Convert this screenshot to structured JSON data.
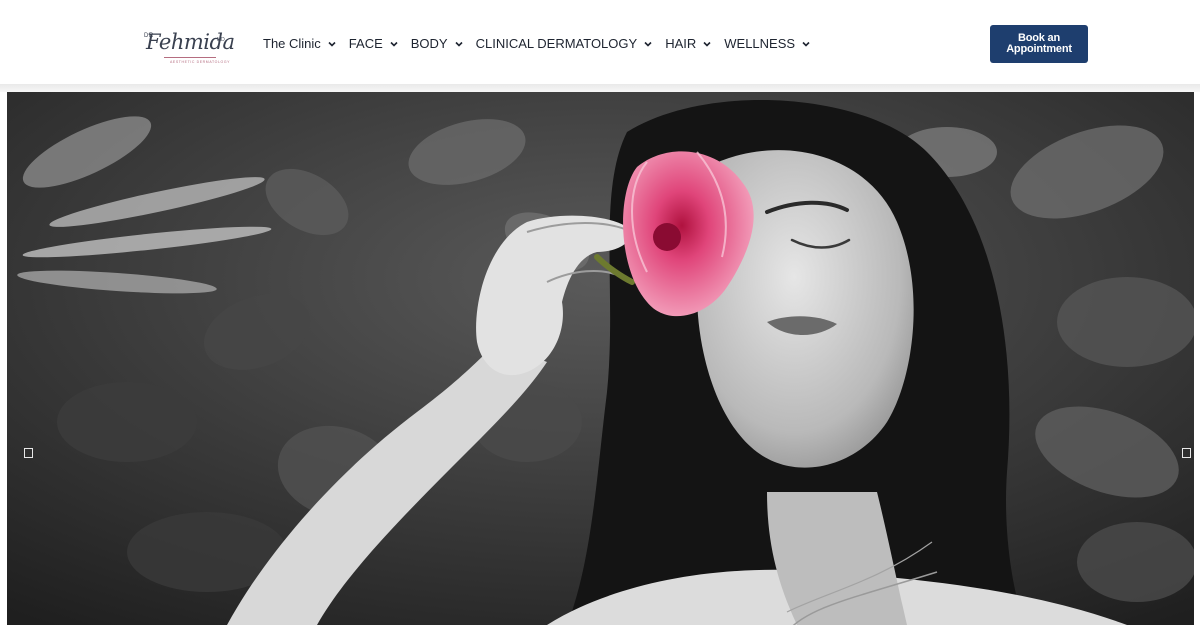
{
  "brand": {
    "prefix": "DR",
    "script": "Fehmida",
    "suffix": "MD",
    "tagline": "AESTHETIC DERMATOLOGY",
    "accent_color": "#b56d80"
  },
  "nav": {
    "items": [
      {
        "label": "The Clinic",
        "icon": "chevron-down-icon"
      },
      {
        "label": "FACE",
        "icon": "chevron-down-icon"
      },
      {
        "label": "BODY",
        "icon": "chevron-down-icon"
      },
      {
        "label": "CLINICAL DERMATOLOGY",
        "icon": "chevron-down-icon"
      },
      {
        "label": "HAIR",
        "icon": "chevron-down-icon"
      },
      {
        "label": "WELLNESS",
        "icon": "chevron-down-icon"
      }
    ]
  },
  "cta": {
    "line1": "Book an",
    "line2": "Appointment",
    "color": "#1e3e6e"
  },
  "hero": {
    "image": "black-and-white-portrait-woman-holding-pink-flower",
    "accent_color": "#e0457a"
  },
  "slider": {
    "prev_icon": "arrow-left-icon",
    "next_icon": "arrow-right-icon"
  }
}
